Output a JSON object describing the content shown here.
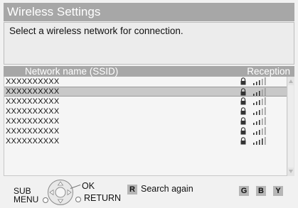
{
  "header": {
    "title": "Wireless Settings"
  },
  "instructions": "Select a wireless network for connection.",
  "list": {
    "columns": {
      "name": "Network name (SSID)",
      "reception": "Reception"
    },
    "rows": [
      {
        "ssid": "XXXXXXXXXX",
        "secured": true,
        "signal": 3,
        "selected": false
      },
      {
        "ssid": "XXXXXXXXXX",
        "secured": true,
        "signal": 3,
        "selected": true
      },
      {
        "ssid": "XXXXXXXXXX",
        "secured": true,
        "signal": 3,
        "selected": false
      },
      {
        "ssid": "XXXXXXXXXX",
        "secured": true,
        "signal": 3,
        "selected": false
      },
      {
        "ssid": "XXXXXXXXXX",
        "secured": true,
        "signal": 3,
        "selected": false
      },
      {
        "ssid": "XXXXXXXXXX",
        "secured": true,
        "signal": 3,
        "selected": false
      },
      {
        "ssid": "XXXXXXXXXX",
        "secured": true,
        "signal": 4,
        "selected": false
      }
    ]
  },
  "footer": {
    "sub_menu_line1": "SUB",
    "sub_menu_line2": "MENU",
    "ok_label": "OK",
    "return_label": "RETURN",
    "r_key": "R",
    "search_again": "Search again",
    "g_key": "G",
    "b_key": "B",
    "y_key": "Y"
  },
  "colors": {
    "title_bg": "#a7a7a7",
    "selected_row": "#c8c8c8",
    "key_bg": "#b6b6b6"
  }
}
